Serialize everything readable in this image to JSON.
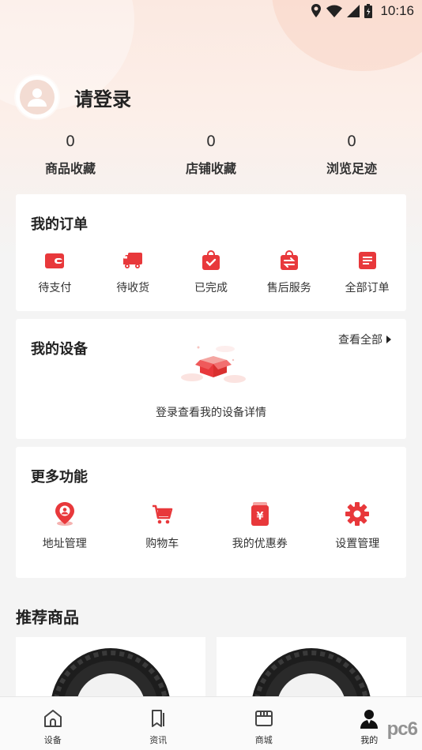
{
  "status_bar": {
    "time": "10:16"
  },
  "profile": {
    "login_text": "请登录"
  },
  "stats": [
    {
      "value": "0",
      "label": "商品收藏"
    },
    {
      "value": "0",
      "label": "店铺收藏"
    },
    {
      "value": "0",
      "label": "浏览足迹"
    }
  ],
  "orders": {
    "title": "我的订单",
    "items": [
      {
        "label": "待支付",
        "icon": "wallet-icon"
      },
      {
        "label": "待收货",
        "icon": "truck-icon"
      },
      {
        "label": "已完成",
        "icon": "bag-check-icon"
      },
      {
        "label": "售后服务",
        "icon": "exchange-icon"
      },
      {
        "label": "全部订单",
        "icon": "list-icon"
      }
    ]
  },
  "devices": {
    "title": "我的设备",
    "view_all": "查看全部",
    "empty_text": "登录查看我的设备详情"
  },
  "more": {
    "title": "更多功能",
    "items": [
      {
        "label": "地址管理",
        "icon": "location-pin-icon"
      },
      {
        "label": "购物车",
        "icon": "cart-icon"
      },
      {
        "label": "我的优惠券",
        "icon": "coupon-icon"
      },
      {
        "label": "设置管理",
        "icon": "gear-icon"
      }
    ]
  },
  "recommend": {
    "title": "推荐商品"
  },
  "tabs": [
    {
      "label": "设备",
      "icon": "home-icon"
    },
    {
      "label": "资讯",
      "icon": "bookmark-icon"
    },
    {
      "label": "商城",
      "icon": "store-icon"
    },
    {
      "label": "我的",
      "icon": "user-icon"
    }
  ],
  "watermark": "pc6",
  "colors": {
    "accent": "#e8383b",
    "background": "#f4f4f4"
  }
}
